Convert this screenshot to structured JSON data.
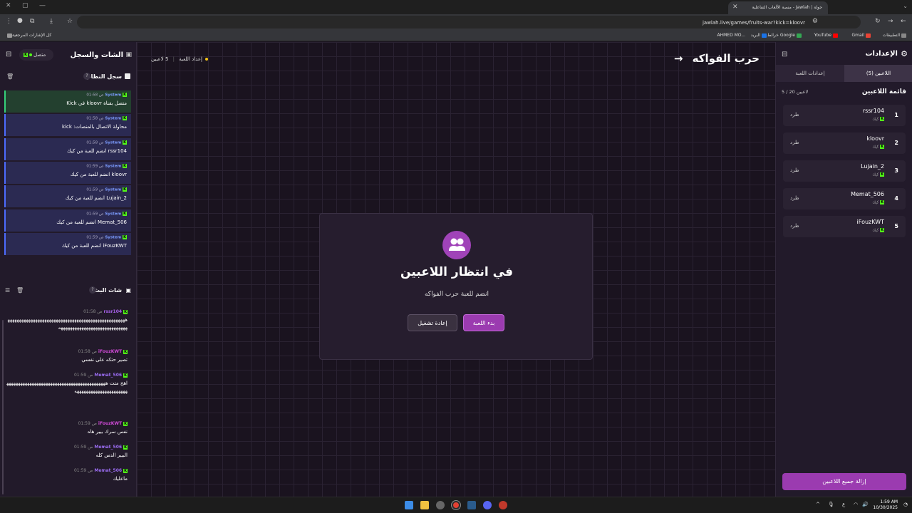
{
  "browser": {
    "tab_title": "جولة | Jawlah - منصة الألعاب التفاعلية",
    "url": "jawlah.live/games/fruits-war?kick=kloovr",
    "bookmarks": [
      "التطبيقات",
      "Gmail",
      "YouTube",
      "خرائط Google",
      "البريد",
      "AHMED MO...",
      "كل الإشارات المرجعية"
    ]
  },
  "left": {
    "title": "الشات والسجل",
    "status": "متصل",
    "log_title": "سجل النظام",
    "log_count": "?",
    "log": [
      {
        "user": "System",
        "time": "01:58 ص",
        "text": "متصل بقناة kloovr في Kick"
      },
      {
        "user": "System",
        "time": "01:58 ص",
        "text": "محاولة الاتصال بالمنصات: kick"
      },
      {
        "user": "System",
        "time": "01:58 ص",
        "text": "rssr104 انضم للعبة من كيك"
      },
      {
        "user": "System",
        "time": "01:59 ص",
        "text": "kloovr انضم للعبة من كيك"
      },
      {
        "user": "System",
        "time": "01:59 ص",
        "text": "Lujain_2 انضم للعبة من كيك"
      },
      {
        "user": "System",
        "time": "01:59 ص",
        "text": "Memat_506 انضم للعبة من كيك"
      },
      {
        "user": "System",
        "time": "01:59 ص",
        "text": "iFouzKWT انضم للعبة من كيك"
      }
    ],
    "chat_title": "شات البث",
    "chat_count": "?",
    "chat": [
      {
        "user": "rssr104",
        "time": "01:58 ص",
        "text": "هههههههههههههههههههههههههههههههههههههههههههههههههههههههههههههههههههههههههههههههههه",
        "color": "#a660e8"
      },
      {
        "user": "iFouzKWT",
        "time": "01:58 ص",
        "text": "تصير حتكه على نفسي",
        "color": "#d14ad8"
      },
      {
        "user": "Memat_506",
        "time": "01:59 ص",
        "text": "اهخ متت ههههههههههههههههههههههههههههههههههههههههههههههههههههههههههههههههههه",
        "color": "#9a6cf0"
      },
      {
        "user": "iFouzKWT",
        "time": "01:59 ص",
        "text": "نفس سرك بيير هاه",
        "color": "#d14ad8"
      },
      {
        "user": "Memat_506",
        "time": "01:59 ص",
        "text": "البيير الدس كله",
        "color": "#9a6cf0"
      },
      {
        "user": "Memat_506",
        "time": "01:59 ص",
        "text": "ماعليك",
        "color": "#9a6cf0"
      }
    ]
  },
  "center": {
    "game_title": "حرب الفواكه",
    "players_info": "5 لاعبين",
    "setup_label": "إعداد اللعبة",
    "card": {
      "title": "في انتظار اللاعبين",
      "subtitle": "انضم للعبة حرب الفواكه",
      "start_label": "بدء اللعبة",
      "restart_label": "إعادة تشغيل"
    }
  },
  "right": {
    "title": "الإعدادات",
    "tabs": [
      "اللاعبين (5)",
      "إعدادات اللعبة"
    ],
    "list_title": "قائمة اللاعبين",
    "list_count": "5 / 20 لاعبين",
    "players": [
      {
        "num": "1",
        "name": "rssr104",
        "platform": "كيك",
        "kick_label": "طرد"
      },
      {
        "num": "2",
        "name": "kloovr",
        "platform": "كيك",
        "kick_label": "طرد"
      },
      {
        "num": "3",
        "name": "Lujain_2",
        "platform": "كيك",
        "kick_label": "طرد"
      },
      {
        "num": "4",
        "name": "Memat_506",
        "platform": "كيك",
        "kick_label": "طرد"
      },
      {
        "num": "5",
        "name": "iFouzKWT",
        "platform": "كيك",
        "kick_label": "طرد"
      }
    ],
    "remove_all_label": "إزالة جميع اللاعبين"
  },
  "taskbar": {
    "time": "1:59 AM",
    "date": "10/30/2025",
    "lang": "ع"
  },
  "colors": {
    "accent": "#9b3bb0",
    "kick": "#53fc18",
    "system": "#4d6bff"
  }
}
